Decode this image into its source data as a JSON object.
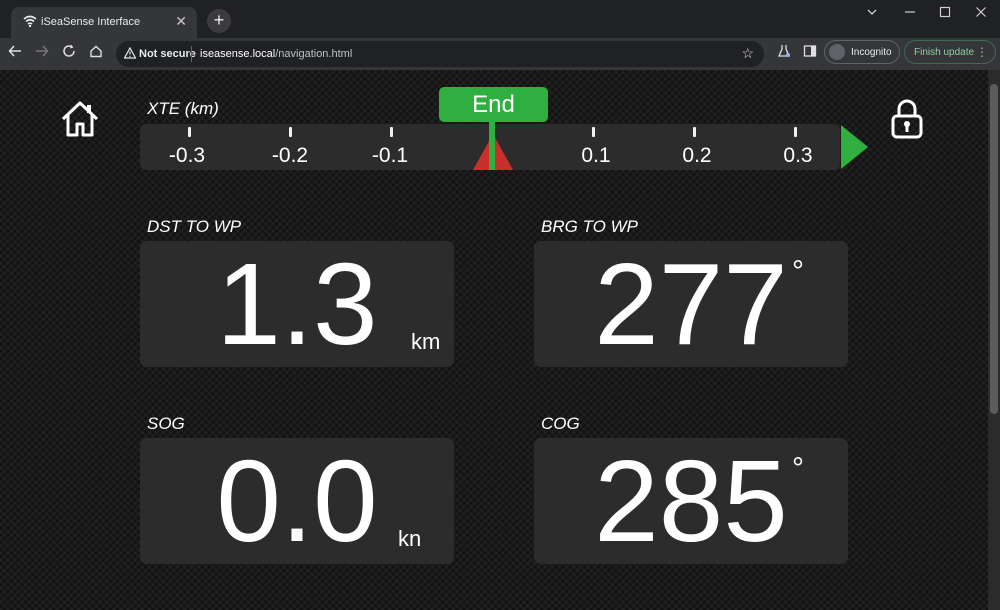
{
  "browser": {
    "tab_title": "iSeaSense Interface",
    "tab_close": "✕",
    "new_tab": "+",
    "security": "Not secure",
    "url_host": "iseasense.local",
    "url_path": "/navigation.html",
    "incognito_label": "Incognito",
    "update_label": "Finish update"
  },
  "xte": {
    "label": "XTE (km)",
    "ticks": [
      "-0.3",
      "-0.2",
      "-0.1",
      "0.1",
      "0.2",
      "0.3"
    ],
    "status": "End",
    "value": 0.0
  },
  "dst": {
    "label": "DST TO WP",
    "value": "1.3",
    "unit": "km"
  },
  "brg": {
    "label": "BRG TO WP",
    "value": "277",
    "unit": "°"
  },
  "sog": {
    "label": "SOG",
    "value": "0.0",
    "unit": "kn"
  },
  "cog": {
    "label": "COG",
    "value": "285",
    "unit": "°"
  },
  "colors": {
    "accent": "#2eaf3f",
    "warning": "#c9302c",
    "panel": "#2c2c2c"
  },
  "icons": [
    "wifi-icon",
    "home-icon",
    "lock-icon",
    "alert-triangle-icon",
    "star-icon",
    "lab-icon",
    "sidepanel-icon",
    "incognito-icon"
  ]
}
